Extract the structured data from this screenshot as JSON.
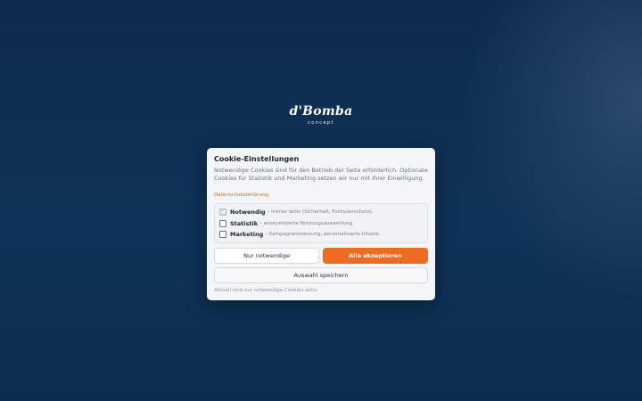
{
  "logo": {
    "name": "d'Bomba",
    "tagline": "concept"
  },
  "cookie_dialog": {
    "title": "Cookie-Einstellungen",
    "intro": "Notwendige Cookies sind für den Betrieb der Seite erforderlich. Optionale Cookies für Statistik und Marketing setzen wir nur mit Ihrer Einwilligung.",
    "policy_link": "Datenschutzerklärung",
    "options": [
      {
        "name": "Notwendig",
        "description": "– immer aktiv (Sicherheit, Formularschutz).",
        "checked": true,
        "disabled": true
      },
      {
        "name": "Statistik",
        "description": "– anonymisierte Nutzungsauswertung.",
        "checked": false,
        "disabled": false
      },
      {
        "name": "Marketing",
        "description": "– Kampagnenmessung, personalisierte Inhalte.",
        "checked": false,
        "disabled": false
      }
    ],
    "buttons": {
      "necessary_only": "Nur notwendige",
      "accept_all": "Alle akzeptieren",
      "save_selection": "Auswahl speichern"
    },
    "status_text": "Aktuell sind nur notwendige Cookies aktiv."
  },
  "colors": {
    "accent": "#ec6d22",
    "background": "#0f3358"
  }
}
